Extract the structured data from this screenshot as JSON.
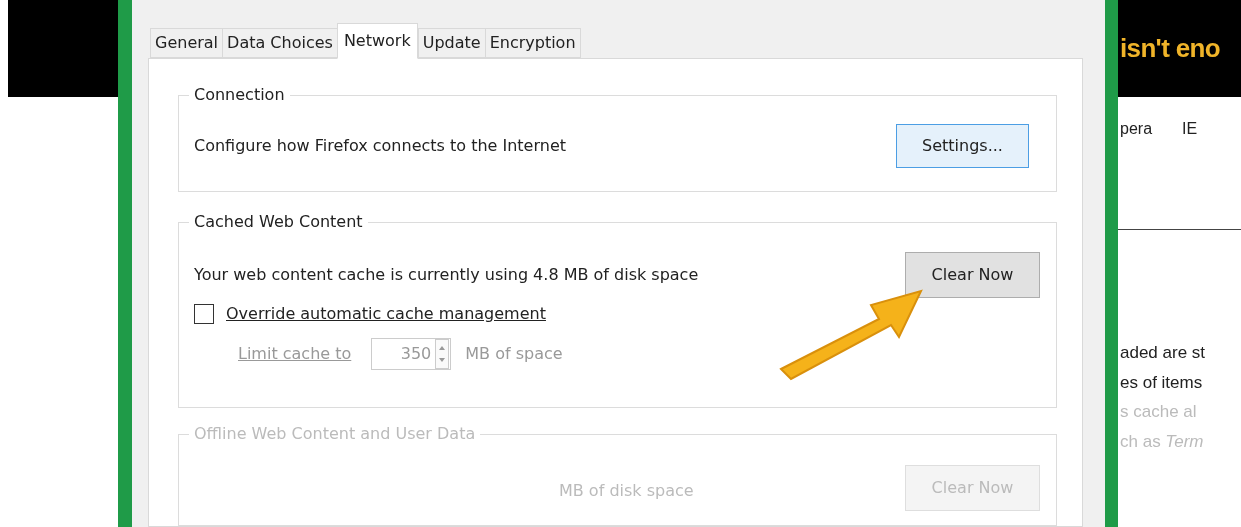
{
  "background_page": {
    "banner_text": "isn't eno",
    "columns": [
      "pera",
      "IE"
    ],
    "paragraph_lines": [
      "aded are st",
      "es of items",
      "s cache al",
      "ch as *Term*"
    ]
  },
  "dialog": {
    "tabs": [
      {
        "label": "General",
        "selected": false
      },
      {
        "label": "Data Choices",
        "selected": false
      },
      {
        "label": "Network",
        "selected": true
      },
      {
        "label": "Update",
        "selected": false
      },
      {
        "label": "Encryption",
        "selected": false
      }
    ],
    "connection": {
      "title": "Connection",
      "description": "Configure how Firefox connects to the Internet",
      "button": "Settings..."
    },
    "cached_web_content": {
      "title": "Cached Web Content",
      "description": "Your web content cache is currently using 4.8 MB of disk space",
      "button": "Clear Now",
      "override": {
        "label": "Override automatic cache management",
        "checked": false
      },
      "limit": {
        "label": "Limit cache to",
        "value": "350",
        "unit": "MB of space",
        "disabled": true
      }
    },
    "offline_web_content": {
      "title": "Offline Web Content and User Data",
      "description": "MB of disk space",
      "button": "Clear Now"
    }
  }
}
